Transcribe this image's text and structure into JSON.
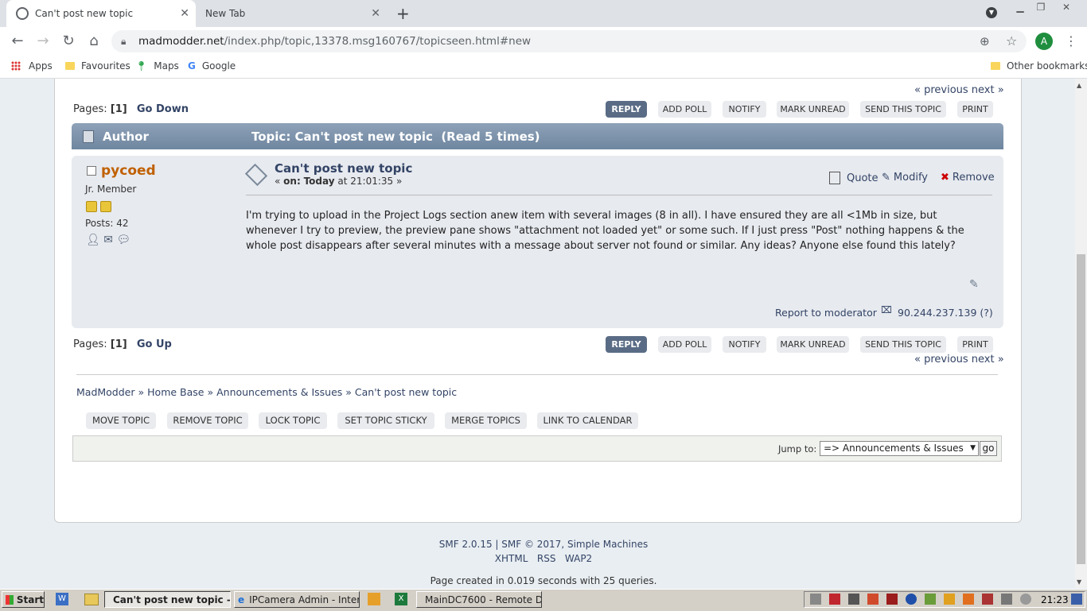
{
  "browser": {
    "tabs": [
      {
        "title": "Can't post new topic",
        "active": true
      },
      {
        "title": "New Tab",
        "active": false
      }
    ],
    "url_host": "madmodder.net",
    "url_path": "/index.php/topic,13378.msg160767/topicseen.html#new",
    "profile_initial": "A",
    "bookmarks": [
      {
        "label": "Apps",
        "icon": "apps-grid-icon"
      },
      {
        "label": "Favourites",
        "icon": "folder-icon"
      },
      {
        "label": "Maps",
        "icon": "maps-pin-icon"
      },
      {
        "label": "Google",
        "icon": "google-g-icon"
      }
    ],
    "other_bookmarks": "Other bookmarks"
  },
  "topic": {
    "prev_next_top": "« previous next »",
    "pages_label": "Pages:",
    "page_num": "[1]",
    "go_down": "Go Down",
    "go_up": "Go Up",
    "actions": [
      "REPLY",
      "ADD POLL",
      "NOTIFY",
      "MARK UNREAD",
      "SEND THIS TOPIC",
      "PRINT"
    ],
    "header_author": "Author",
    "header_topic": "Topic: Can't post new topic  (Read 5 times)",
    "prev_next_bottom": "« previous next »"
  },
  "post": {
    "author": "pycoed",
    "rank": "Jr. Member",
    "posts": "Posts: 42",
    "subject": "Can't post new topic",
    "date_prefix": "«",
    "date_on": "on:",
    "date_today": "Today",
    "date_time": "at 21:01:35 »",
    "quote": "Quote",
    "modify": "Modify",
    "remove": "Remove",
    "body": "I'm trying to upload in the Project Logs section anew item with several images (8 in all). I have ensured they are all <1Mb in size, but whenever I try to preview, the preview pane shows \"attachment not loaded yet\" or some such. If I just press \"Post\" nothing happens & the whole post disappears after several minutes with a message about server not found or similar. Any ideas? Anyone else found this lately?",
    "report": "Report to moderator",
    "ip": "90.244.237.139 (?)"
  },
  "breadcrumb": [
    "MadModder",
    "Home Base",
    "Announcements & Issues",
    "Can't post new topic"
  ],
  "breadcrumb_sep": "»",
  "mod_buttons": [
    "MOVE TOPIC",
    "REMOVE TOPIC",
    "LOCK TOPIC",
    "SET TOPIC STICKY",
    "MERGE TOPICS",
    "LINK TO CALENDAR"
  ],
  "jump": {
    "label": "Jump to:",
    "selected": "=> Announcements & Issues",
    "go": "go"
  },
  "footer": {
    "line1": "SMF 2.0.15 | SMF © 2017, Simple Machines",
    "xhtml": "XHTML",
    "rss": "RSS",
    "wap2": "WAP2",
    "created": "Page created in 0.019 seconds with 25 queries."
  },
  "taskbar": {
    "start": "Start",
    "tasks": [
      "Can't post new topic -...",
      "IPCamera Admin - Intern...",
      "MainDC7600 - Remote D..."
    ],
    "clock": "21:23"
  }
}
